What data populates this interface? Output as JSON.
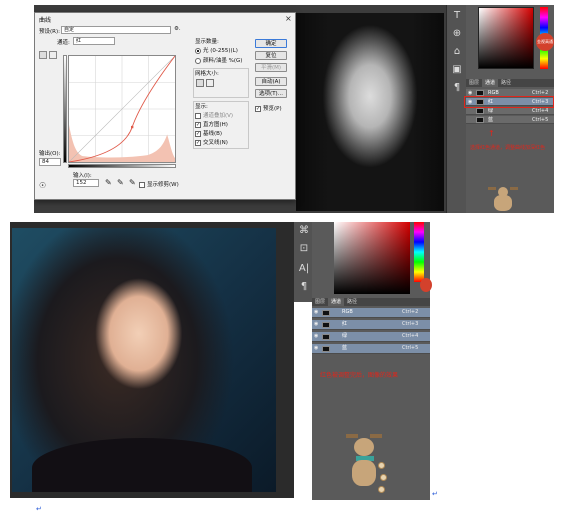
{
  "top": {
    "dialog": {
      "title": "曲线",
      "preset_label": "预设(R):",
      "preset_value": "自定",
      "channel_label": "通道:",
      "channel_value": "红",
      "output_label": "输出(O):",
      "output_value": "84",
      "input_label": "输入(I):",
      "input_value": "152",
      "show_clipping": "显示修剪(W)",
      "display_amount_title": "显示数量:",
      "light_option": "光 (0-255)(L)",
      "pigment_option": "颜料/油墨 %(G)",
      "grid_size_title": "网格大小:",
      "show_title": "显示:",
      "show_options": [
        "通道叠加(V)",
        "直方图(H)",
        "基线(B)",
        "交叉线(N)"
      ],
      "show_checked": [
        false,
        true,
        true,
        true
      ],
      "buttons": {
        "ok": "确定",
        "reset": "复位",
        "smooth": "平滑(M)",
        "auto": "自动(A)",
        "options": "选项(T)..."
      },
      "preview_label": "预览(P)",
      "curve": {
        "color": "#e05a4a",
        "point": {
          "input": 152,
          "output": 84
        },
        "histogram_color": "#f3c2b2"
      }
    },
    "panel": {
      "tabs": [
        "图层",
        "通道",
        "路径"
      ],
      "active_tab": 1,
      "badge": "金视高通",
      "channels": [
        {
          "name": "RGB",
          "shortcut": "Ctrl+2"
        },
        {
          "name": "红",
          "shortcut": "Ctrl+3"
        },
        {
          "name": "绿",
          "shortcut": "Ctrl+4"
        },
        {
          "name": "蓝",
          "shortcut": "Ctrl+5"
        }
      ],
      "selected_channel": 1,
      "note": "选择红色通道，调整曲线加深红色"
    },
    "tools": [
      "T",
      "⊕",
      "⌂",
      "▣",
      "¶"
    ]
  },
  "bottom": {
    "panel": {
      "tabs": [
        "图层",
        "通道",
        "路径"
      ],
      "active_tab": 1,
      "channels": [
        {
          "name": "RGB",
          "shortcut": "Ctrl+2"
        },
        {
          "name": "红",
          "shortcut": "Ctrl+3"
        },
        {
          "name": "绿",
          "shortcut": "Ctrl+4"
        },
        {
          "name": "蓝",
          "shortcut": "Ctrl+5"
        }
      ],
      "note": "红色被调整完后，图像的效果"
    },
    "tools": [
      "⌘",
      "⊡",
      "A|",
      "¶"
    ]
  },
  "paragraph_mark": "↵",
  "colors": {
    "accent_red": "#e0261c",
    "panel_bg": "#5a5a5a",
    "selected_row": "#7c8fa8"
  }
}
